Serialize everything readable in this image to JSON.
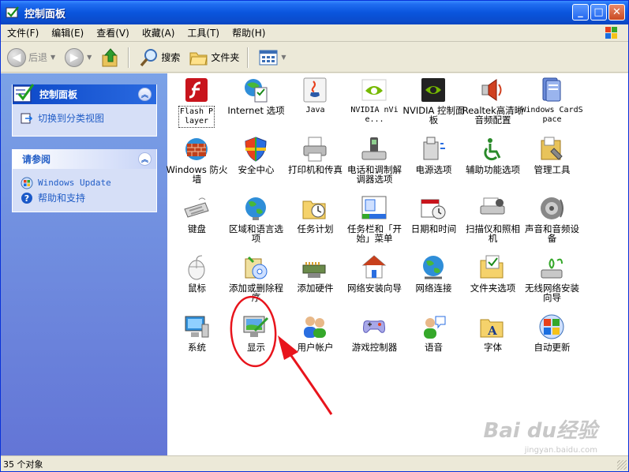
{
  "window": {
    "title": "控制面板"
  },
  "menu": [
    "文件(F)",
    "编辑(E)",
    "查看(V)",
    "收藏(A)",
    "工具(T)",
    "帮助(H)"
  ],
  "toolbar": {
    "back": "后退",
    "search": "搜索",
    "folders": "文件夹"
  },
  "sidebar": {
    "panel1": {
      "title": "控制面板",
      "links": [
        "切换到分类视图"
      ]
    },
    "panel2": {
      "title": "请参阅",
      "links": [
        "Windows Update",
        "帮助和支持"
      ]
    }
  },
  "items": [
    {
      "label": "Flash Player",
      "icon": "flash-icon"
    },
    {
      "label": "Internet 选项",
      "icon": "internet-options-icon"
    },
    {
      "label": "Java",
      "icon": "java-icon"
    },
    {
      "label": "NVIDIA nVie...",
      "icon": "nvidia-icon"
    },
    {
      "label": "NVIDIA 控制面板",
      "icon": "nvidia-control-icon"
    },
    {
      "label": "Realtek高清晰音频配置",
      "icon": "speaker-icon"
    },
    {
      "label": "Windows CardSpace",
      "icon": "cardspace-icon"
    },
    {
      "label": "Windows 防火墙",
      "icon": "firewall-icon"
    },
    {
      "label": "安全中心",
      "icon": "shield-icon"
    },
    {
      "label": "打印机和传真",
      "icon": "printer-icon"
    },
    {
      "label": "电话和调制解调器选项",
      "icon": "phone-icon"
    },
    {
      "label": "电源选项",
      "icon": "power-icon"
    },
    {
      "label": "辅助功能选项",
      "icon": "accessibility-icon"
    },
    {
      "label": "管理工具",
      "icon": "admin-tools-icon"
    },
    {
      "label": "键盘",
      "icon": "keyboard-icon"
    },
    {
      "label": "区域和语言选项",
      "icon": "globe-icon"
    },
    {
      "label": "任务计划",
      "icon": "folder-clock-icon"
    },
    {
      "label": "任务栏和「开始」菜单",
      "icon": "taskbar-icon"
    },
    {
      "label": "日期和时间",
      "icon": "calendar-icon"
    },
    {
      "label": "扫描仪和照相机",
      "icon": "scanner-icon"
    },
    {
      "label": "声音和音频设备",
      "icon": "sound-icon"
    },
    {
      "label": "鼠标",
      "icon": "mouse-icon"
    },
    {
      "label": "添加或删除程序",
      "icon": "add-remove-icon"
    },
    {
      "label": "添加硬件",
      "icon": "hardware-icon"
    },
    {
      "label": "网络安装向导",
      "icon": "network-wizard-icon"
    },
    {
      "label": "网络连接",
      "icon": "network-icon"
    },
    {
      "label": "文件夹选项",
      "icon": "folder-options-icon"
    },
    {
      "label": "无线网络安装向导",
      "icon": "wireless-icon"
    },
    {
      "label": "系统",
      "icon": "system-icon"
    },
    {
      "label": "显示",
      "icon": "display-icon"
    },
    {
      "label": "用户帐户",
      "icon": "users-icon"
    },
    {
      "label": "游戏控制器",
      "icon": "gamepad-icon"
    },
    {
      "label": "语音",
      "icon": "speech-icon"
    },
    {
      "label": "字体",
      "icon": "fonts-icon"
    },
    {
      "label": "自动更新",
      "icon": "windows-update-icon"
    }
  ],
  "status": {
    "count": "35 个对象"
  },
  "watermark": {
    "logo": "Bai du经验",
    "url": "jingyan.baidu.com"
  },
  "colors": {
    "accent": "#0a55dd",
    "sidebar": "#7ba2e7",
    "annotation": "#e8141c"
  }
}
